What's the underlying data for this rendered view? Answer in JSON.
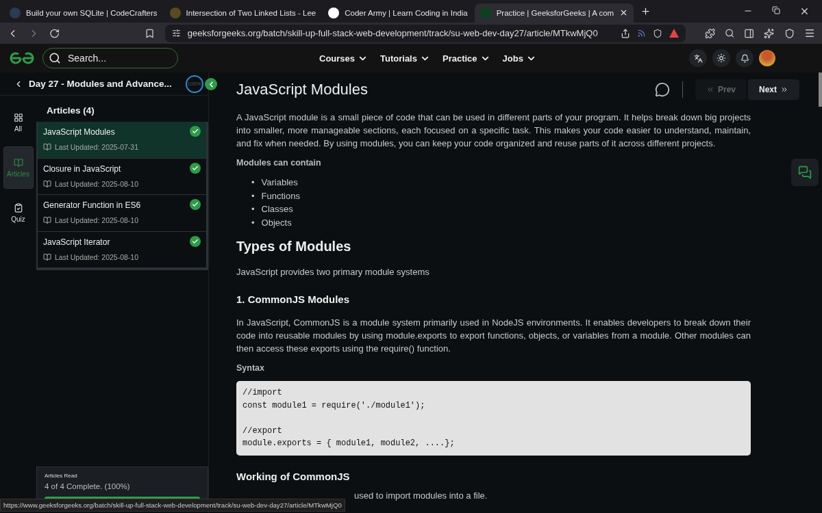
{
  "browser": {
    "tabs": [
      {
        "title": "Build your own SQLite | CodeCrafters",
        "selected": false
      },
      {
        "title": "Intersection of Two Linked Lists - Lee",
        "selected": false
      },
      {
        "title": "Coder Army | Learn Coding in India",
        "selected": false
      },
      {
        "title": "Practice | GeeksforGeeks | A com",
        "selected": true
      }
    ],
    "url": "geeksforgeeks.org/batch/skill-up-full-stack-web-development/track/su-web-dev-day27/article/MTkwMjQ0",
    "status_url": "https://www.geeksforgeeks.org/batch/skill-up-full-stack-web-development/track/su-web-dev-day27/article/MTkwMjQ0"
  },
  "header": {
    "search": {
      "placeholder": "Search..."
    },
    "nav": [
      "Courses",
      "Tutorials",
      "Practice",
      "Jobs"
    ]
  },
  "sidebar": {
    "title": "Day 27 - Modules and Advance...",
    "progress": "100%",
    "rail": [
      {
        "label": "All",
        "selected": false
      },
      {
        "label": "Articles",
        "selected": true
      },
      {
        "label": "Quiz",
        "selected": false
      }
    ],
    "articles_heading": "Articles (4)",
    "articles": [
      {
        "title": "JavaScript Modules",
        "updated": "Last Updated: 2025-07-31",
        "selected": true,
        "done": true
      },
      {
        "title": "Closure in JavaScript",
        "updated": "Last Updated: 2025-08-10",
        "selected": false,
        "done": true
      },
      {
        "title": "Generator Function in ES6",
        "updated": "Last Updated: 2025-08-10",
        "selected": false,
        "done": true
      },
      {
        "title": "JavaScript Iterator",
        "updated": "Last Updated: 2025-08-10",
        "selected": false,
        "done": true
      }
    ],
    "read": {
      "label": "Articles Read",
      "text": "4 of 4 Complete. (100%)",
      "level": 1
    }
  },
  "article": {
    "title": "JavaScript Modules",
    "prev": {
      "label": "Prev",
      "disabled": true
    },
    "next": {
      "label": "Next",
      "disabled": false
    },
    "blocks": [
      {
        "kind": "p",
        "text": "A JavaScript module is a small piece of code that can be used in different parts of your program. It helps break down big projects into smaller, more manageable sections, each focused on a specific task. This makes your code easier to understand, maintain, and fix when needed. By using modules, you can keep your code organized and reuse parts of it across different projects."
      },
      {
        "kind": "label",
        "text": "Modules can contain"
      },
      {
        "kind": "list",
        "marker": "•",
        "items": [
          "Variables",
          "Functions",
          "Classes",
          "Objects"
        ]
      },
      {
        "kind": "h2",
        "text": "Types of Modules"
      },
      {
        "kind": "p",
        "text": "JavaScript provides two primary module systems"
      },
      {
        "kind": "h3",
        "text": "1. CommonJS Modules"
      },
      {
        "kind": "p",
        "text": "In JavaScript, CommonJS is a module system primarily used in NodeJS environments. It enables developers to break down their code into reusable modules by using module.exports to export functions, objects, or variables from a module. Other modules can then access these exports using the require() function."
      },
      {
        "kind": "label",
        "text": "Syntax"
      },
      {
        "kind": "code",
        "groups": [
          [
            "//import",
            "const module1 = require('./module1');"
          ],
          [
            "//export",
            "module.exports = { module1, module2, ....};"
          ]
        ]
      },
      {
        "kind": "h3",
        "text": "Working of CommonJS"
      },
      {
        "kind": "partial",
        "text": "used to import modules into a file."
      }
    ]
  }
}
